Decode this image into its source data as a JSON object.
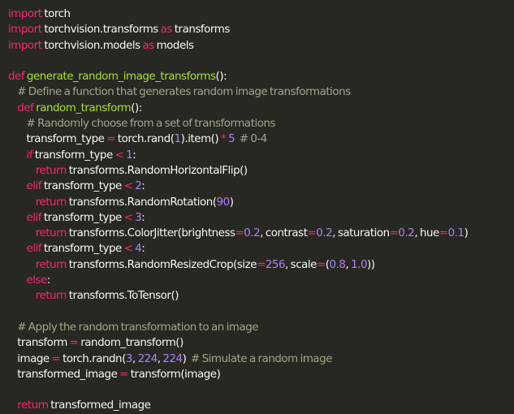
{
  "editor": {
    "colors": {
      "background": "#272822",
      "text": "#f8f8f2",
      "keyword": "#f92672",
      "function": "#a6e22e",
      "number": "#ae81ff",
      "comment": "#a6a48c"
    },
    "lines": [
      [
        [
          "keyword",
          "import"
        ],
        [
          "text",
          " torch"
        ]
      ],
      [
        [
          "keyword",
          "import"
        ],
        [
          "text",
          " torchvision.transforms "
        ],
        [
          "keyword",
          "as"
        ],
        [
          "text",
          " transforms"
        ]
      ],
      [
        [
          "keyword",
          "import"
        ],
        [
          "text",
          " torchvision.models "
        ],
        [
          "keyword",
          "as"
        ],
        [
          "text",
          " models"
        ]
      ],
      [],
      [
        [
          "keyword",
          "def"
        ],
        [
          "text",
          " "
        ],
        [
          "func",
          "generate_random_image_transforms"
        ],
        [
          "text",
          "():"
        ]
      ],
      [
        [
          "text",
          "    "
        ],
        [
          "comment",
          "# Define a function that generates random image transformations"
        ]
      ],
      [
        [
          "text",
          "    "
        ],
        [
          "keyword",
          "def"
        ],
        [
          "text",
          " "
        ],
        [
          "func",
          "random_transform"
        ],
        [
          "text",
          "():"
        ]
      ],
      [
        [
          "text",
          "        "
        ],
        [
          "comment",
          "# Randomly choose from a set of transformations"
        ]
      ],
      [
        [
          "text",
          "        transform_type "
        ],
        [
          "op",
          "="
        ],
        [
          "text",
          " torch.rand("
        ],
        [
          "num",
          "1"
        ],
        [
          "text",
          ").item() "
        ],
        [
          "op",
          "*"
        ],
        [
          "text",
          " "
        ],
        [
          "num",
          "5"
        ],
        [
          "text",
          "  "
        ],
        [
          "comment",
          "# 0-4"
        ]
      ],
      [
        [
          "text",
          "        "
        ],
        [
          "keyword",
          "if"
        ],
        [
          "text",
          " transform_type "
        ],
        [
          "op",
          "<"
        ],
        [
          "text",
          " "
        ],
        [
          "num",
          "1"
        ],
        [
          "text",
          ":"
        ]
      ],
      [
        [
          "text",
          "            "
        ],
        [
          "keyword",
          "return"
        ],
        [
          "text",
          " transforms.RandomHorizontalFlip()"
        ]
      ],
      [
        [
          "text",
          "        "
        ],
        [
          "keyword",
          "elif"
        ],
        [
          "text",
          " transform_type "
        ],
        [
          "op",
          "<"
        ],
        [
          "text",
          " "
        ],
        [
          "num",
          "2"
        ],
        [
          "text",
          ":"
        ]
      ],
      [
        [
          "text",
          "            "
        ],
        [
          "keyword",
          "return"
        ],
        [
          "text",
          " transforms.RandomRotation("
        ],
        [
          "num",
          "90"
        ],
        [
          "text",
          ")"
        ]
      ],
      [
        [
          "text",
          "        "
        ],
        [
          "keyword",
          "elif"
        ],
        [
          "text",
          " transform_type "
        ],
        [
          "op",
          "<"
        ],
        [
          "text",
          " "
        ],
        [
          "num",
          "3"
        ],
        [
          "text",
          ":"
        ]
      ],
      [
        [
          "text",
          "            "
        ],
        [
          "keyword",
          "return"
        ],
        [
          "text",
          " transforms.ColorJitter(brightness"
        ],
        [
          "op",
          "="
        ],
        [
          "num",
          "0.2"
        ],
        [
          "text",
          ", contrast"
        ],
        [
          "op",
          "="
        ],
        [
          "num",
          "0.2"
        ],
        [
          "text",
          ", saturation"
        ],
        [
          "op",
          "="
        ],
        [
          "num",
          "0.2"
        ],
        [
          "text",
          ", hue"
        ],
        [
          "op",
          "="
        ],
        [
          "num",
          "0.1"
        ],
        [
          "text",
          ")"
        ]
      ],
      [
        [
          "text",
          "        "
        ],
        [
          "keyword",
          "elif"
        ],
        [
          "text",
          " transform_type "
        ],
        [
          "op",
          "<"
        ],
        [
          "text",
          " "
        ],
        [
          "num",
          "4"
        ],
        [
          "text",
          ":"
        ]
      ],
      [
        [
          "text",
          "            "
        ],
        [
          "keyword",
          "return"
        ],
        [
          "text",
          " transforms.RandomResizedCrop(size"
        ],
        [
          "op",
          "="
        ],
        [
          "num",
          "256"
        ],
        [
          "text",
          ", scale"
        ],
        [
          "op",
          "="
        ],
        [
          "text",
          "("
        ],
        [
          "num",
          "0.8"
        ],
        [
          "text",
          ", "
        ],
        [
          "num",
          "1.0"
        ],
        [
          "text",
          "))"
        ]
      ],
      [
        [
          "text",
          "        "
        ],
        [
          "keyword",
          "else"
        ],
        [
          "text",
          ":"
        ]
      ],
      [
        [
          "text",
          "            "
        ],
        [
          "keyword",
          "return"
        ],
        [
          "text",
          " transforms.ToTensor()"
        ]
      ],
      [],
      [
        [
          "text",
          "    "
        ],
        [
          "comment",
          "# Apply the random transformation to an image"
        ]
      ],
      [
        [
          "text",
          "    transform "
        ],
        [
          "op",
          "="
        ],
        [
          "text",
          " random_transform()"
        ]
      ],
      [
        [
          "text",
          "    image "
        ],
        [
          "op",
          "="
        ],
        [
          "text",
          " torch.randn("
        ],
        [
          "num",
          "3"
        ],
        [
          "text",
          ", "
        ],
        [
          "num",
          "224"
        ],
        [
          "text",
          ", "
        ],
        [
          "num",
          "224"
        ],
        [
          "text",
          ")  "
        ],
        [
          "comment",
          "# Simulate a random image"
        ]
      ],
      [
        [
          "text",
          "    transformed_image "
        ],
        [
          "op",
          "="
        ],
        [
          "text",
          " transform(image)"
        ]
      ],
      [],
      [
        [
          "text",
          "    "
        ],
        [
          "keyword",
          "return"
        ],
        [
          "text",
          " transformed_image"
        ]
      ]
    ]
  }
}
